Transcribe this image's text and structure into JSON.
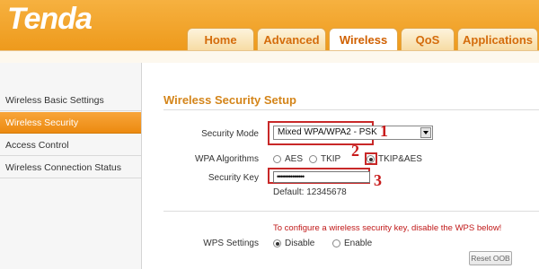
{
  "brand": {
    "logo_text": "Tenda"
  },
  "tabs": [
    {
      "label": "Home"
    },
    {
      "label": "Advanced"
    },
    {
      "label": "Wireless",
      "active": true
    },
    {
      "label": "QoS"
    },
    {
      "label": "Applications"
    }
  ],
  "sidebar": {
    "items": [
      {
        "label": "Wireless Basic Settings"
      },
      {
        "label": "Wireless Security",
        "active": true
      },
      {
        "label": "Access Control"
      },
      {
        "label": "Wireless Connection Status"
      }
    ]
  },
  "main": {
    "title": "Wireless Security Setup",
    "security_mode": {
      "label": "Security Mode",
      "value": "Mixed WPA/WPA2 - PSK"
    },
    "wpa_algorithms": {
      "label": "WPA Algorithms",
      "options": [
        "AES",
        "TKIP",
        "TKIP&AES"
      ],
      "selected": "TKIP&AES"
    },
    "security_key": {
      "label": "Security Key",
      "value": "••••••••••••••",
      "default_text": "Default: 12345678"
    },
    "wps_warning": "To configure a wireless security key, disable the WPS below!",
    "wps": {
      "label": "WPS Settings",
      "options": [
        "Disable",
        "Enable"
      ],
      "selected": "Disable"
    },
    "reset_oob_label": "Reset OOB"
  },
  "annotations": [
    "1",
    "2",
    "3"
  ],
  "colors": {
    "brand_orange": "#ee9a1c",
    "title_orange": "#d4851a",
    "annotation_red": "#c81c1c",
    "warning_red": "#c01818"
  }
}
